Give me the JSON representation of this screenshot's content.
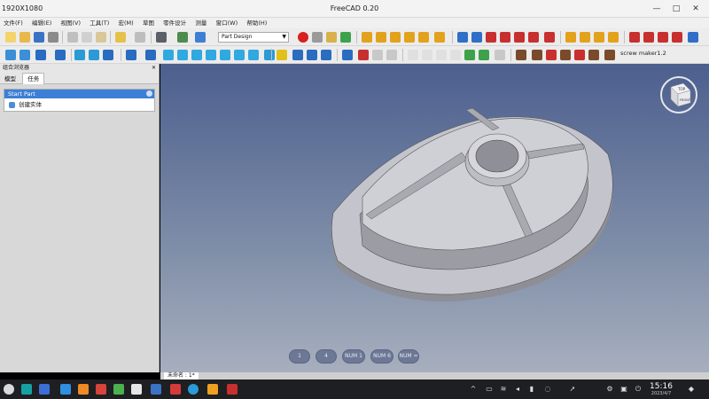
{
  "window": {
    "resolution_label": "1920X1080",
    "title": "FreeCAD 0.20",
    "minimize": "—",
    "maximize": "□",
    "close": "✕"
  },
  "menu": [
    "文件(F)",
    "编辑(E)",
    "视图(V)",
    "工具(T)",
    "宏(M)",
    "草图",
    "零件设计",
    "测量",
    "窗口(W)",
    "帮助(H)"
  ],
  "toolbar": {
    "workbench_combo": "Part Design",
    "screw_label": "screw maker1.2"
  },
  "left_panel": {
    "title": "组合浏览器",
    "tabs": [
      "模型",
      "任务"
    ],
    "active_tab": "任务",
    "task_box_title": "Start Part",
    "task_item": "创建实体"
  },
  "viewport": {
    "navcube_top": "TOP",
    "navcube_front": "FRONT",
    "numpad": [
      "1",
      "4",
      "NUM 1",
      "NUM 6",
      "NUM ="
    ],
    "doc_tab": "未命名 : 1*"
  },
  "taskbar": {
    "time": "15:16",
    "date": "2023/4/7"
  },
  "colors": {
    "accent": "#3d7fd6",
    "view_top": "#4c5f8e",
    "view_bottom": "#a7afbe",
    "part": "#c9c9cf"
  }
}
